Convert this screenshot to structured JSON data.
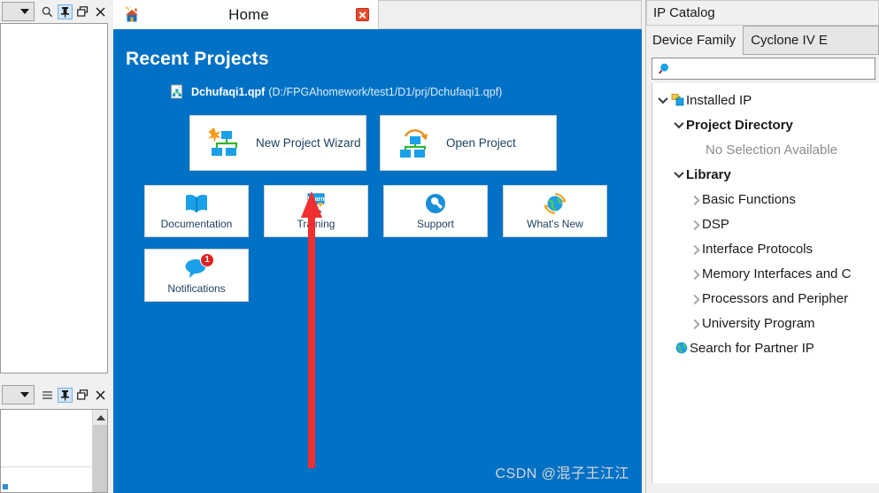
{
  "left_panels": {
    "top": {
      "combo_value": "",
      "buttons": [
        {
          "name": "search-icon",
          "label": "search"
        },
        {
          "name": "pin-icon",
          "label": "pin",
          "active": true
        },
        {
          "name": "restore-icon",
          "label": "restore"
        },
        {
          "name": "close-icon",
          "label": "x"
        }
      ]
    },
    "bottom": {
      "combo_value": "",
      "buttons": [
        {
          "name": "menu-icon",
          "label": "menu"
        },
        {
          "name": "pin-icon",
          "label": "pin",
          "active": true
        },
        {
          "name": "restore-icon",
          "label": "restore"
        },
        {
          "name": "close-icon",
          "label": "x"
        }
      ]
    }
  },
  "center": {
    "tab": {
      "label": "Home",
      "icon": "home-icon",
      "close_label": "x"
    },
    "home": {
      "title": "Recent Projects",
      "recent_project": {
        "name": "Dchufaqi1.qpf",
        "path": "(D:/FPGAhomework/test1/D1/prj/Dchufaqi1.qpf)"
      },
      "primary_buttons": [
        {
          "label": "New Project Wizard",
          "icon": "new-project-wizard-icon"
        },
        {
          "label": "Open Project",
          "icon": "open-project-icon"
        }
      ],
      "secondary_buttons": [
        {
          "label": "Documentation",
          "icon": "book-icon"
        },
        {
          "label": "Training",
          "icon": "training-board-icon"
        },
        {
          "label": "Support",
          "icon": "wrench-icon"
        },
        {
          "label": "What's New",
          "icon": "globe-refresh-icon"
        }
      ],
      "notifications": {
        "label": "Notifications",
        "badge_count": "1",
        "icon": "speech-bubble-icon"
      },
      "background_color": "#0071c5"
    },
    "annotation": {
      "type": "arrow-up",
      "color": "#f03030",
      "target": "New Project Wizard"
    }
  },
  "right": {
    "title": "IP Catalog",
    "device_family": {
      "label": "Device Family",
      "value": "Cyclone IV E"
    },
    "search": {
      "value": "",
      "placeholder": "",
      "icon": "magnifier-icon"
    },
    "tree": [
      {
        "label": "Installed IP",
        "indent": 0,
        "twisty": "down",
        "icon": "ip-block-icon",
        "bold": false,
        "muted": false
      },
      {
        "label": "Project Directory",
        "indent": 1,
        "twisty": "down",
        "icon": "",
        "bold": true,
        "muted": false
      },
      {
        "label": "No Selection Available",
        "indent": 2,
        "twisty": "none",
        "icon": "",
        "bold": false,
        "muted": true
      },
      {
        "label": "Library",
        "indent": 1,
        "twisty": "down",
        "icon": "",
        "bold": true,
        "muted": false
      },
      {
        "label": "Basic Functions",
        "indent": 2,
        "twisty": "right",
        "icon": "",
        "bold": false,
        "muted": false
      },
      {
        "label": "DSP",
        "indent": 2,
        "twisty": "right",
        "icon": "",
        "bold": false,
        "muted": false
      },
      {
        "label": "Interface Protocols",
        "indent": 2,
        "twisty": "right",
        "icon": "",
        "bold": false,
        "muted": false
      },
      {
        "label": "Memory Interfaces and C",
        "indent": 2,
        "twisty": "right",
        "icon": "",
        "bold": false,
        "muted": false
      },
      {
        "label": "Processors and Peripher",
        "indent": 2,
        "twisty": "right",
        "icon": "",
        "bold": false,
        "muted": false
      },
      {
        "label": "University Program",
        "indent": 2,
        "twisty": "right",
        "icon": "",
        "bold": false,
        "muted": false
      },
      {
        "label": "Search for Partner IP",
        "indent": 0,
        "twisty": "none",
        "icon": "globe-icon",
        "bold": false,
        "muted": false
      }
    ]
  },
  "watermark": "CSDN @混子王江江"
}
